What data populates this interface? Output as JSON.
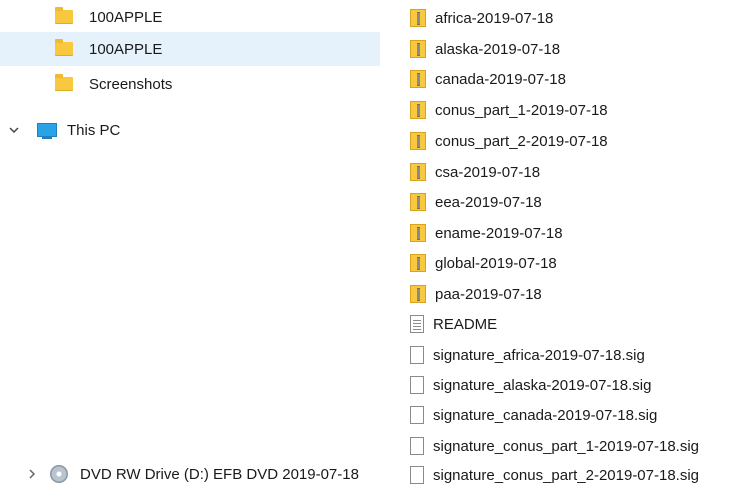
{
  "navigation": {
    "items": [
      {
        "label": "100APPLE",
        "icon": "folder-icon",
        "selected": false
      },
      {
        "label": "100APPLE",
        "icon": "folder-icon",
        "selected": true
      },
      {
        "label": "Screenshots",
        "icon": "folder-icon",
        "selected": false
      },
      {
        "label": "This PC",
        "icon": "computer-icon",
        "expander": "chevron-down-icon"
      },
      {
        "label": "DVD RW Drive (D:) EFB DVD 2019-07-18",
        "icon": "dvd-drive-icon",
        "expander": "chevron-right-icon"
      }
    ]
  },
  "files": [
    {
      "name": "africa-2019-07-18",
      "icon": "zip-folder-icon"
    },
    {
      "name": "alaska-2019-07-18",
      "icon": "zip-folder-icon"
    },
    {
      "name": "canada-2019-07-18",
      "icon": "zip-folder-icon"
    },
    {
      "name": "conus_part_1-2019-07-18",
      "icon": "zip-folder-icon"
    },
    {
      "name": "conus_part_2-2019-07-18",
      "icon": "zip-folder-icon"
    },
    {
      "name": "csa-2019-07-18",
      "icon": "zip-folder-icon"
    },
    {
      "name": "eea-2019-07-18",
      "icon": "zip-folder-icon"
    },
    {
      "name": "ename-2019-07-18",
      "icon": "zip-folder-icon"
    },
    {
      "name": "global-2019-07-18",
      "icon": "zip-folder-icon"
    },
    {
      "name": "paa-2019-07-18",
      "icon": "zip-folder-icon"
    },
    {
      "name": "README",
      "icon": "text-file-icon"
    },
    {
      "name": "signature_africa-2019-07-18.sig",
      "icon": "file-icon"
    },
    {
      "name": "signature_alaska-2019-07-18.sig",
      "icon": "file-icon"
    },
    {
      "name": "signature_canada-2019-07-18.sig",
      "icon": "file-icon"
    },
    {
      "name": "signature_conus_part_1-2019-07-18.sig",
      "icon": "file-icon"
    },
    {
      "name": "signature_conus_part_2-2019-07-18.sig",
      "icon": "file-icon"
    }
  ],
  "colors": {
    "selection": "#e5f1fb",
    "folder": "#f8c93e",
    "computer": "#29a3e6"
  }
}
